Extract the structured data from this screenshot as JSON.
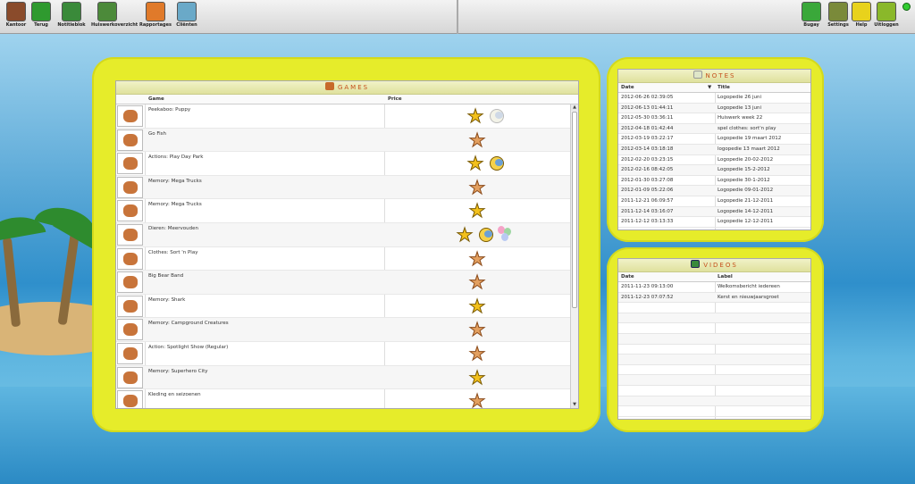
{
  "toolbar": {
    "left": [
      {
        "label": "Kantoor",
        "icon": "office-icon",
        "color": "#8a4b2b"
      },
      {
        "label": "Terug",
        "icon": "back-arrow-icon",
        "color": "#2f9a2f"
      },
      {
        "label": "Notitieblok",
        "icon": "notepad-icon",
        "color": "#3a8a3a"
      },
      {
        "label": "Huiswerkoverzicht",
        "icon": "backpack-icon",
        "color": "#4c8a3a"
      },
      {
        "label": "Rapportages",
        "icon": "report-bag-icon",
        "color": "#e07a2a"
      },
      {
        "label": "Cliënten",
        "icon": "client-person-icon",
        "color": "#6aa9c8"
      }
    ],
    "right": [
      {
        "label": "Bugay",
        "icon": "recycle-icon",
        "color": "#3aa83a"
      },
      {
        "label": "Settings",
        "icon": "tools-icon",
        "color": "#7a8a3a"
      },
      {
        "label": "Help",
        "icon": "help-icon",
        "color": "#e8d21c"
      },
      {
        "label": "Uitloggen",
        "icon": "logout-car-icon",
        "color": "#8ab82a"
      }
    ],
    "status_color": "#33cc33"
  },
  "games": {
    "title": "GAMES",
    "columns": {
      "game": "Game",
      "price": "Price"
    },
    "rows": [
      {
        "name": "Peekaboo: Puppy",
        "price": [
          "gold-star",
          "pale-bear"
        ]
      },
      {
        "name": "Go Fish",
        "price": [
          "bronze-star"
        ]
      },
      {
        "name": "Actions: Play Day Park",
        "price": [
          "gold-star",
          "bear"
        ]
      },
      {
        "name": "Memory: Mega Trucks",
        "price": [
          "bronze-star"
        ]
      },
      {
        "name": "Memory: Mega Trucks",
        "price": [
          "gold-star"
        ]
      },
      {
        "name": "Dieren: Meervouden",
        "price": [
          "gold-star",
          "bear",
          "balloons"
        ]
      },
      {
        "name": "Clothes: Sort 'n Play",
        "price": [
          "bronze-star"
        ]
      },
      {
        "name": "Big Bear Band",
        "price": [
          "bronze-star"
        ]
      },
      {
        "name": "Memory: Shark",
        "price": [
          "gold-star"
        ]
      },
      {
        "name": "Memory: Campground Creatures",
        "price": [
          "bronze-star"
        ]
      },
      {
        "name": "Action: Spotlight Show (Regular)",
        "price": [
          "bronze-star"
        ]
      },
      {
        "name": "Memory: Superhero City",
        "price": [
          "gold-star"
        ]
      },
      {
        "name": "Kleding en seizoenen",
        "price": [
          "bronze-star"
        ]
      }
    ]
  },
  "notes": {
    "title": "NOTES",
    "columns": {
      "date": "Date",
      "title": "Title"
    },
    "rows": [
      {
        "date": "2012-06-26 02:39:05",
        "title": "Logopedie 26 juni"
      },
      {
        "date": "2012-06-13 01:44:11",
        "title": "Logopedie 13 juni"
      },
      {
        "date": "2012-05-30 03:36:11",
        "title": "Huiswerk week 22"
      },
      {
        "date": "2012-04-18 01:42:44",
        "title": "spel clothes: sort'n play"
      },
      {
        "date": "2012-03-19 03:22:17",
        "title": "Logopedie 19 maart 2012"
      },
      {
        "date": "2012-03-14 03:18:18",
        "title": "logopedie 13 maart 2012"
      },
      {
        "date": "2012-02-20 03:23:15",
        "title": "Logopedie 20-02-2012"
      },
      {
        "date": "2012-02-16 08:42:05",
        "title": "Logopedie 15-2-2012"
      },
      {
        "date": "2012-01-30 03:27:08",
        "title": "Logopedie 30-1-2012"
      },
      {
        "date": "2012-01-09 05:22:06",
        "title": "Logopedie 09-01-2012"
      },
      {
        "date": "2011-12-21 06:09:57",
        "title": "Logopedie 21-12-2011"
      },
      {
        "date": "2011-12-14 03:16:07",
        "title": "Logopedie 14-12-2011"
      },
      {
        "date": "2011-12-12 03:13:33",
        "title": "Logopedie 12-12-2011"
      }
    ]
  },
  "videos": {
    "title": "VIDEOS",
    "columns": {
      "date": "Date",
      "label": "Label"
    },
    "rows": [
      {
        "date": "2011-11-23 09:13:00",
        "label": "Welkomsbericht iedereen"
      },
      {
        "date": "2011-12-23 07:07:52",
        "label": "Kerst en nieuwjaarsgroet"
      }
    ]
  }
}
